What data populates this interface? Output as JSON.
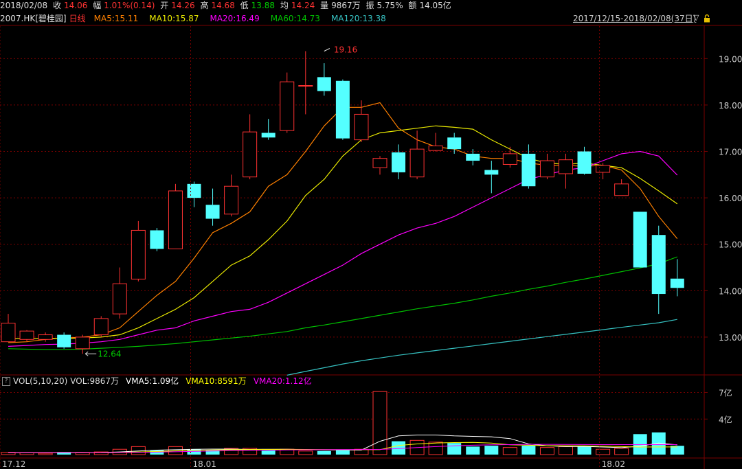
{
  "info": {
    "date": "2018/02/08",
    "close_label": "收",
    "close": "14.06",
    "change_label": "幅",
    "change": "1.01%(0.14)",
    "open_label": "开",
    "open": "14.26",
    "high_label": "高",
    "high": "14.68",
    "low_label": "低",
    "low": "13.88",
    "avg_label": "均",
    "avg": "14.24",
    "vol_label": "量",
    "vol": "9867万",
    "amp_label": "振",
    "amp": "5.75%",
    "amt_label": "额",
    "amt": "14.05亿"
  },
  "ma_bar": {
    "symbol": "2007.HK",
    "name": "[碧桂园]",
    "period": "日线",
    "ma5": "MA5:15.11",
    "ma10": "MA10:15.87",
    "ma20": "MA20:16.49",
    "ma60": "MA60:14.73",
    "ma120": "MA120:13.38",
    "range": "2017/12/15-2018/02/08(37日)"
  },
  "vol_bar": {
    "title": "VOL(5,10,20)",
    "vol": "VOL:9867万",
    "vma5": "VMA5:1.09亿",
    "vma10": "VMA10:8591万",
    "vma20": "VMA20:1.12亿"
  },
  "colors": {
    "up": "#ff3232",
    "down": "#54ffff",
    "ma5": "#ff8000",
    "ma10": "#e8e800",
    "ma20": "#ff00ff",
    "ma60": "#00c000",
    "ma120": "#36c2c2",
    "grid": "#7a0000",
    "vma5": "#ffffff",
    "vma10": "#ffff00",
    "vma20": "#ff00ff"
  },
  "chart_data": {
    "type": "candlestick",
    "y_ticks": [
      "19.00",
      "18.00",
      "17.00",
      "16.00",
      "15.00",
      "14.00",
      "13.00"
    ],
    "ylim": [
      12.2,
      19.7
    ],
    "vol_ticks": [
      "7亿",
      "4亿"
    ],
    "vol_ylim": [
      0,
      7.5
    ],
    "x_ticks": [
      {
        "index": 0,
        "label": "17.12"
      },
      {
        "index": 10,
        "label": "18.01"
      },
      {
        "index": 32,
        "label": "18.02"
      }
    ],
    "annotations": [
      {
        "label": "19.16",
        "index": 17,
        "value": 19.16
      },
      {
        "label": "12.64",
        "index": 4,
        "value": 12.64
      }
    ],
    "candles": [
      {
        "o": 12.9,
        "h": 13.5,
        "l": 12.9,
        "c": 13.3,
        "v": 0.25
      },
      {
        "o": 12.95,
        "h": 13.15,
        "l": 12.9,
        "c": 13.13,
        "v": 0.2
      },
      {
        "o": 12.95,
        "h": 13.1,
        "l": 12.9,
        "c": 13.05,
        "v": 0.15
      },
      {
        "o": 13.05,
        "h": 13.1,
        "l": 12.75,
        "c": 12.78,
        "v": 0.3
      },
      {
        "o": 12.75,
        "h": 13.05,
        "l": 12.64,
        "c": 13.0,
        "v": 0.25
      },
      {
        "o": 13.05,
        "h": 13.45,
        "l": 13.0,
        "c": 13.4,
        "v": 0.3
      },
      {
        "o": 13.5,
        "h": 14.5,
        "l": 13.4,
        "c": 14.15,
        "v": 0.6
      },
      {
        "o": 14.25,
        "h": 15.5,
        "l": 14.2,
        "c": 15.3,
        "v": 0.9
      },
      {
        "o": 15.3,
        "h": 15.35,
        "l": 14.85,
        "c": 14.9,
        "v": 0.5
      },
      {
        "o": 14.9,
        "h": 16.3,
        "l": 14.9,
        "c": 16.15,
        "v": 0.9
      },
      {
        "o": 16.3,
        "h": 16.35,
        "l": 15.8,
        "c": 16.0,
        "v": 0.6
      },
      {
        "o": 15.85,
        "h": 16.2,
        "l": 15.4,
        "c": 15.55,
        "v": 0.5
      },
      {
        "o": 15.65,
        "h": 16.5,
        "l": 15.6,
        "c": 16.25,
        "v": 0.7
      },
      {
        "o": 16.45,
        "h": 17.8,
        "l": 16.4,
        "c": 17.42,
        "v": 0.7
      },
      {
        "o": 17.4,
        "h": 17.7,
        "l": 17.25,
        "c": 17.3,
        "v": 0.5
      },
      {
        "o": 17.45,
        "h": 18.7,
        "l": 17.4,
        "c": 18.5,
        "v": 0.6
      },
      {
        "o": 18.42,
        "h": 19.16,
        "l": 17.8,
        "c": 18.42,
        "v": 0.4
      },
      {
        "o": 18.6,
        "h": 18.9,
        "l": 18.2,
        "c": 18.3,
        "v": 0.4
      },
      {
        "o": 18.52,
        "h": 18.55,
        "l": 17.25,
        "c": 17.28,
        "v": 0.5
      },
      {
        "o": 17.25,
        "h": 18.1,
        "l": 17.2,
        "c": 17.8,
        "v": 0.6
      },
      {
        "o": 16.65,
        "h": 16.9,
        "l": 16.5,
        "c": 16.85,
        "v": 7.1
      },
      {
        "o": 16.98,
        "h": 17.15,
        "l": 16.4,
        "c": 16.55,
        "v": 1.5
      },
      {
        "o": 16.45,
        "h": 17.45,
        "l": 16.4,
        "c": 17.05,
        "v": 1.6
      },
      {
        "o": 17.02,
        "h": 17.4,
        "l": 17.0,
        "c": 17.12,
        "v": 1.4
      },
      {
        "o": 17.3,
        "h": 17.4,
        "l": 16.95,
        "c": 17.05,
        "v": 1.3
      },
      {
        "o": 16.95,
        "h": 17.05,
        "l": 16.7,
        "c": 16.8,
        "v": 0.9
      },
      {
        "o": 16.6,
        "h": 16.8,
        "l": 16.1,
        "c": 16.5,
        "v": 1.0
      },
      {
        "o": 16.72,
        "h": 17.1,
        "l": 16.65,
        "c": 16.95,
        "v": 0.8
      },
      {
        "o": 16.95,
        "h": 17.15,
        "l": 16.2,
        "c": 16.25,
        "v": 1.0
      },
      {
        "o": 16.45,
        "h": 16.95,
        "l": 16.4,
        "c": 16.8,
        "v": 0.8
      },
      {
        "o": 16.52,
        "h": 16.95,
        "l": 16.2,
        "c": 16.82,
        "v": 0.9
      },
      {
        "o": 17.0,
        "h": 17.1,
        "l": 16.5,
        "c": 16.52,
        "v": 0.9
      },
      {
        "o": 16.55,
        "h": 16.75,
        "l": 16.4,
        "c": 16.7,
        "v": 0.6
      },
      {
        "o": 16.05,
        "h": 16.4,
        "l": 16.05,
        "c": 16.3,
        "v": 0.7
      },
      {
        "o": 15.7,
        "h": 15.7,
        "l": 14.5,
        "c": 14.5,
        "v": 2.3
      },
      {
        "o": 15.2,
        "h": 15.4,
        "l": 13.5,
        "c": 13.93,
        "v": 2.5
      },
      {
        "o": 14.26,
        "h": 14.68,
        "l": 13.88,
        "c": 14.06,
        "v": 0.99
      }
    ],
    "series": [
      {
        "name": "MA5",
        "values": [
          12.88,
          12.9,
          12.95,
          12.98,
          13.0,
          13.05,
          13.2,
          13.55,
          13.9,
          14.2,
          14.7,
          15.25,
          15.45,
          15.7,
          16.25,
          16.5,
          17.0,
          17.55,
          17.95,
          17.95,
          18.05,
          17.5,
          17.25,
          17.1,
          17.05,
          16.9,
          16.85,
          16.85,
          16.75,
          16.7,
          16.7,
          16.68,
          16.7,
          16.6,
          16.2,
          15.6,
          15.12
        ]
      },
      {
        "name": "MA10",
        "values": [
          12.98,
          12.96,
          12.97,
          12.97,
          12.98,
          13.0,
          13.05,
          13.2,
          13.4,
          13.6,
          13.85,
          14.2,
          14.55,
          14.75,
          15.1,
          15.5,
          16.05,
          16.4,
          16.9,
          17.25,
          17.4,
          17.45,
          17.5,
          17.55,
          17.52,
          17.48,
          17.25,
          17.05,
          16.85,
          16.75,
          16.72,
          16.75,
          16.7,
          16.65,
          16.42,
          16.15,
          15.87
        ]
      },
      {
        "name": "MA20",
        "values": [
          12.8,
          12.82,
          12.84,
          12.85,
          12.87,
          12.9,
          12.95,
          13.05,
          13.15,
          13.2,
          13.35,
          13.45,
          13.55,
          13.6,
          13.75,
          13.95,
          14.15,
          14.35,
          14.55,
          14.8,
          15.0,
          15.2,
          15.35,
          15.45,
          15.6,
          15.8,
          16.0,
          16.2,
          16.4,
          16.5,
          16.6,
          16.65,
          16.8,
          16.95,
          17.0,
          16.9,
          16.49
        ]
      },
      {
        "name": "MA60",
        "values": [
          12.75,
          12.74,
          12.73,
          12.73,
          12.74,
          12.76,
          12.78,
          12.8,
          12.83,
          12.86,
          12.9,
          12.94,
          12.98,
          13.02,
          13.07,
          13.12,
          13.2,
          13.26,
          13.33,
          13.4,
          13.47,
          13.54,
          13.61,
          13.67,
          13.73,
          13.8,
          13.88,
          13.95,
          14.03,
          14.1,
          14.18,
          14.25,
          14.33,
          14.41,
          14.49,
          14.58,
          14.73
        ]
      },
      {
        "name": "MA120",
        "values": [
          null,
          null,
          null,
          null,
          null,
          null,
          null,
          null,
          null,
          null,
          null,
          null,
          null,
          null,
          null,
          12.18,
          12.26,
          12.34,
          12.42,
          12.49,
          12.55,
          12.61,
          12.66,
          12.71,
          12.76,
          12.81,
          12.86,
          12.91,
          12.96,
          13.01,
          13.06,
          13.11,
          13.16,
          13.21,
          13.26,
          13.31,
          13.38
        ]
      }
    ],
    "vol_series": [
      {
        "name": "VMA5",
        "values": [
          0.2,
          0.22,
          0.23,
          0.22,
          0.23,
          0.24,
          0.3,
          0.4,
          0.5,
          0.55,
          0.6,
          0.62,
          0.62,
          0.58,
          0.6,
          0.6,
          0.56,
          0.52,
          0.52,
          0.5,
          1.5,
          2.1,
          2.2,
          2.2,
          2.1,
          2.05,
          2.0,
          1.8,
          1.2,
          1.0,
          0.9,
          0.92,
          0.85,
          0.78,
          0.95,
          1.3,
          1.09
        ]
      },
      {
        "name": "VMA10",
        "values": [
          0.22,
          0.22,
          0.22,
          0.22,
          0.22,
          0.23,
          0.25,
          0.3,
          0.35,
          0.42,
          0.47,
          0.52,
          0.55,
          0.57,
          0.58,
          0.59,
          0.58,
          0.56,
          0.55,
          0.55,
          0.55,
          1.02,
          1.2,
          1.3,
          1.35,
          1.38,
          1.3,
          1.1,
          1.05,
          1.0,
          1.0,
          0.98,
          0.95,
          0.9,
          0.85,
          0.86,
          0.86
        ]
      },
      {
        "name": "VMA20",
        "values": [
          0.22,
          0.22,
          0.22,
          0.22,
          0.22,
          0.22,
          0.23,
          0.25,
          0.28,
          0.32,
          0.36,
          0.4,
          0.43,
          0.46,
          0.49,
          0.52,
          0.54,
          0.55,
          0.56,
          0.57,
          0.58,
          0.68,
          0.8,
          0.9,
          0.98,
          1.05,
          1.1,
          1.12,
          1.15,
          1.15,
          1.14,
          1.13,
          1.12,
          1.12,
          1.12,
          1.12,
          1.12
        ]
      }
    ]
  }
}
